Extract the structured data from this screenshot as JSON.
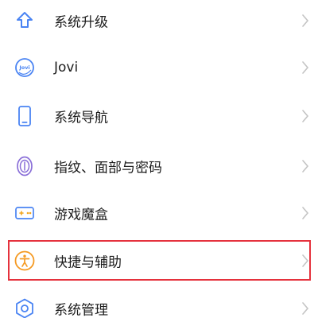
{
  "settings": {
    "items": [
      {
        "label": "系统升级",
        "icon": "upload-arrow-icon"
      },
      {
        "label": "Jovi",
        "icon": "jovi-logo-icon",
        "logo_text": "Jovi"
      },
      {
        "label": "系统导航",
        "icon": "phone-navigation-icon"
      },
      {
        "label": "指纹、面部与密码",
        "icon": "fingerprint-icon"
      },
      {
        "label": "游戏魔盒",
        "icon": "game-box-icon"
      },
      {
        "label": "快捷与辅助",
        "icon": "accessibility-icon"
      },
      {
        "label": "系统管理",
        "icon": "system-management-icon"
      }
    ],
    "highlighted_item": "快捷与辅助"
  },
  "colors": {
    "accent_blue": "#4a84f3",
    "accessibility_orange": "#f59a23",
    "highlight_red": "#e5323d",
    "text": "#1c1c1c",
    "chevron": "#c4c4c4"
  }
}
